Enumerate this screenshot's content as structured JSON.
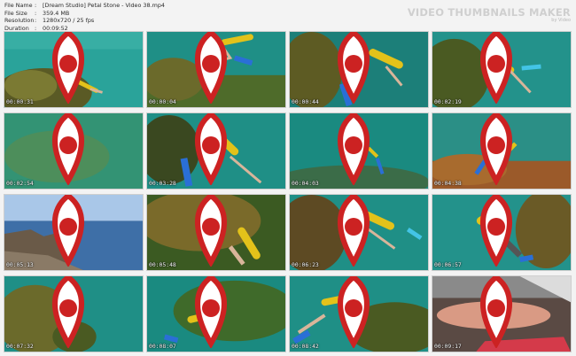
{
  "header": {
    "file_name_label": "File Name",
    "file_name": "[Dream Studio] Petal Stone - Video 38.mp4",
    "file_size_label": "File Size",
    "file_size": "359.4 MB",
    "resolution_label": "Resolution",
    "resolution": "1280x720 / 25 fps",
    "duration_label": "Duration",
    "duration": "00:09:52",
    "separator": ":"
  },
  "brand": {
    "title": "VIDEO THUMBNAILS MAKER",
    "subtitle": "by Video"
  },
  "thumbnails": [
    {
      "time": "00:00:31"
    },
    {
      "time": "00:00:04"
    },
    {
      "time": "00:00:44"
    },
    {
      "time": "00:02:19"
    },
    {
      "time": "00:02:54"
    },
    {
      "time": "00:03:28"
    },
    {
      "time": "00:04:03"
    },
    {
      "time": "00:04:38"
    },
    {
      "time": "00:05:13"
    },
    {
      "time": "00:05:48"
    },
    {
      "time": "00:06:23"
    },
    {
      "time": "00:06:57"
    },
    {
      "time": "00:07:32"
    },
    {
      "time": "00:08:07"
    },
    {
      "time": "00:08:42"
    },
    {
      "time": "00:09:17"
    }
  ],
  "colors": {
    "water": "#1f8f86",
    "deep_water": "#0f5f5a",
    "seaweed": "#6b6a2b",
    "tank": "#e3c21a",
    "fin": "#2a6fd6",
    "sky": "#a9c7e8",
    "sea": "#3e6fa7"
  }
}
